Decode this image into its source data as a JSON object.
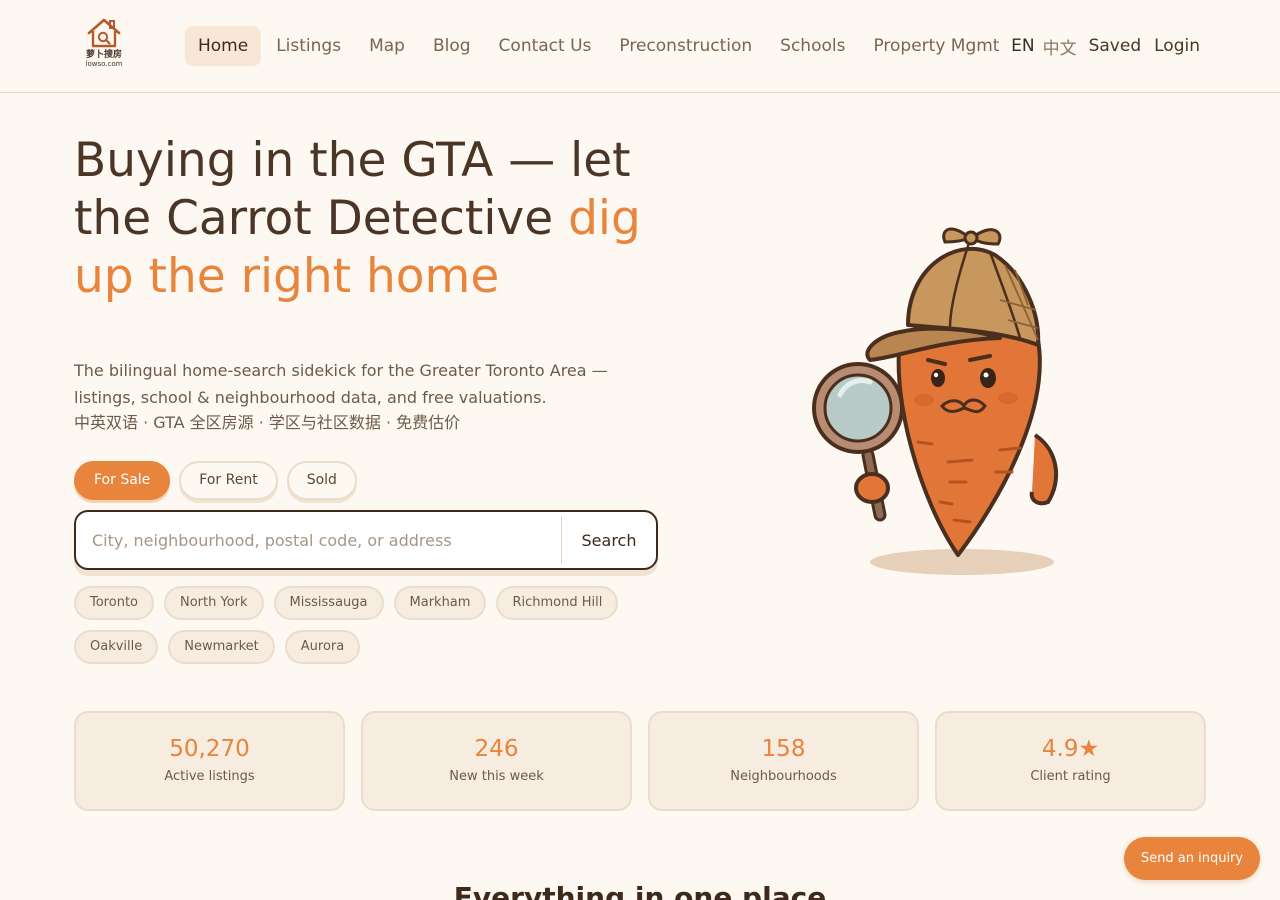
{
  "brand": {
    "name_cn": "萝卜搜房",
    "domain": "lowso.com"
  },
  "nav": {
    "items": [
      {
        "label": "Home",
        "active": true
      },
      {
        "label": "Listings"
      },
      {
        "label": "Map"
      },
      {
        "label": "Blog"
      },
      {
        "label": "Contact Us"
      },
      {
        "label": "Preconstruction"
      },
      {
        "label": "Schools"
      },
      {
        "label": "Property Mgmt"
      }
    ],
    "lang_en": "EN",
    "lang_zh": "中文",
    "saved": "Saved",
    "login": "Login"
  },
  "hero": {
    "title_part1": "Buying in the GTA — let the Carrot Detective ",
    "title_accent": "dig up the right home",
    "subtitle": "The bilingual home-search sidekick for the Greater Toronto Area — listings, school & neighbourhood data, and free valuations.",
    "subtitle_cn": "中英双语 · GTA 全区房源 · 学区与社区数据 · 免费估价"
  },
  "search": {
    "tabs": [
      {
        "label": "For Sale",
        "active": true
      },
      {
        "label": "For Rent"
      },
      {
        "label": "Sold"
      }
    ],
    "placeholder": "City, neighbourhood, postal code, or address",
    "button_label": "Search",
    "cities_row1": [
      "Toronto",
      "North York",
      "Mississauga",
      "Markham",
      "Richmond Hill"
    ],
    "cities_row2": [
      "Oakville",
      "Newmarket",
      "Aurora"
    ]
  },
  "stats": [
    {
      "value": "50,270",
      "label": "Active listings"
    },
    {
      "value": "246",
      "label": "New this week"
    },
    {
      "value": "158",
      "label": "Neighbourhoods"
    },
    {
      "value": "4.9★",
      "label": "Client rating"
    }
  ],
  "section_title": "Everything in one place",
  "inquiry_button": "Send an inquiry",
  "colors": {
    "accent": "#e8843c",
    "background": "#fdf9f2",
    "text_dark": "#4a3526",
    "card_bg": "#f6ece0"
  }
}
